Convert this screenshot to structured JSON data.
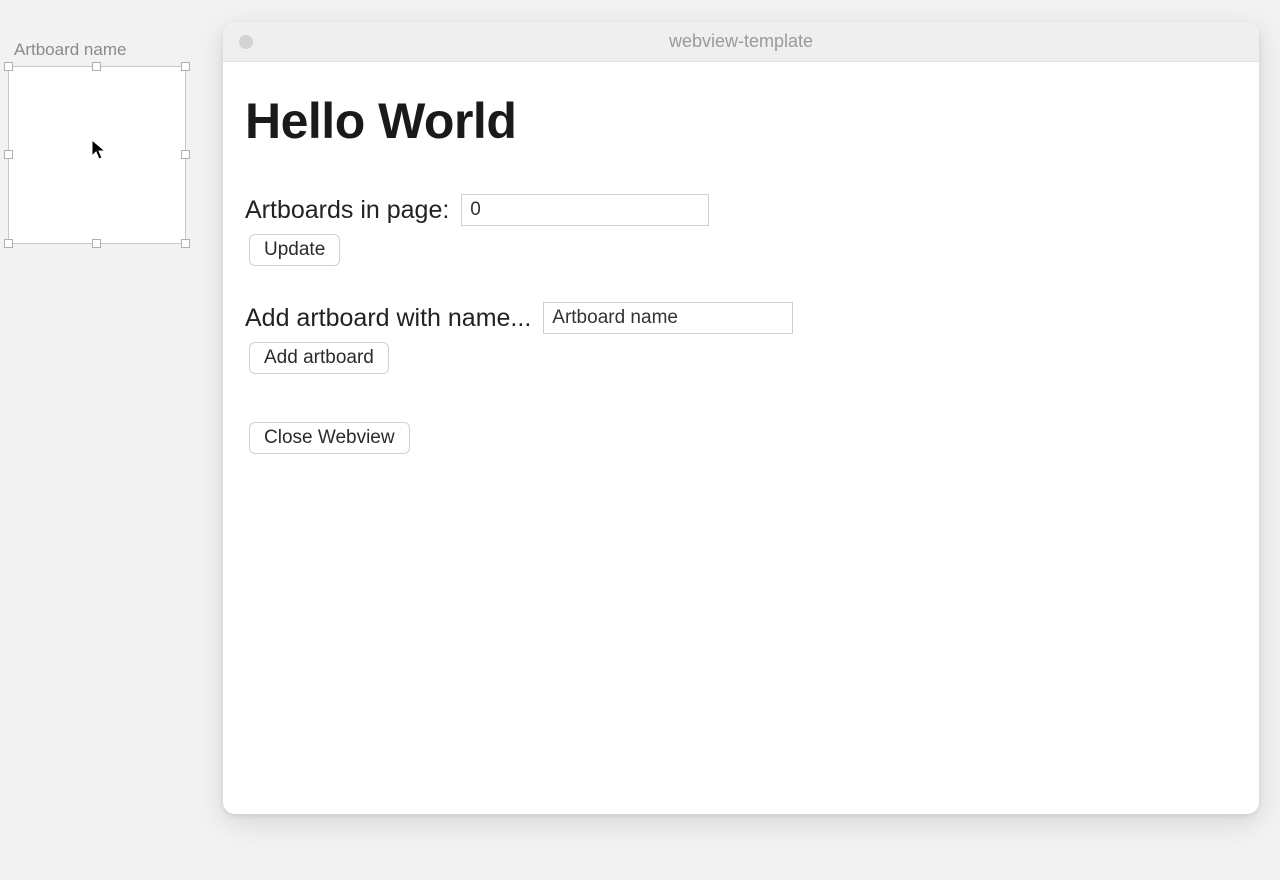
{
  "canvas": {
    "artboard_label": "Artboard name"
  },
  "window": {
    "title": "webview-template"
  },
  "page": {
    "heading": "Hello World",
    "count_label": "Artboards in page:",
    "count_value": "0",
    "update_button": "Update",
    "add_label": "Add artboard with name...",
    "add_name_value": "Artboard name",
    "add_button": "Add artboard",
    "close_button": "Close Webview"
  }
}
